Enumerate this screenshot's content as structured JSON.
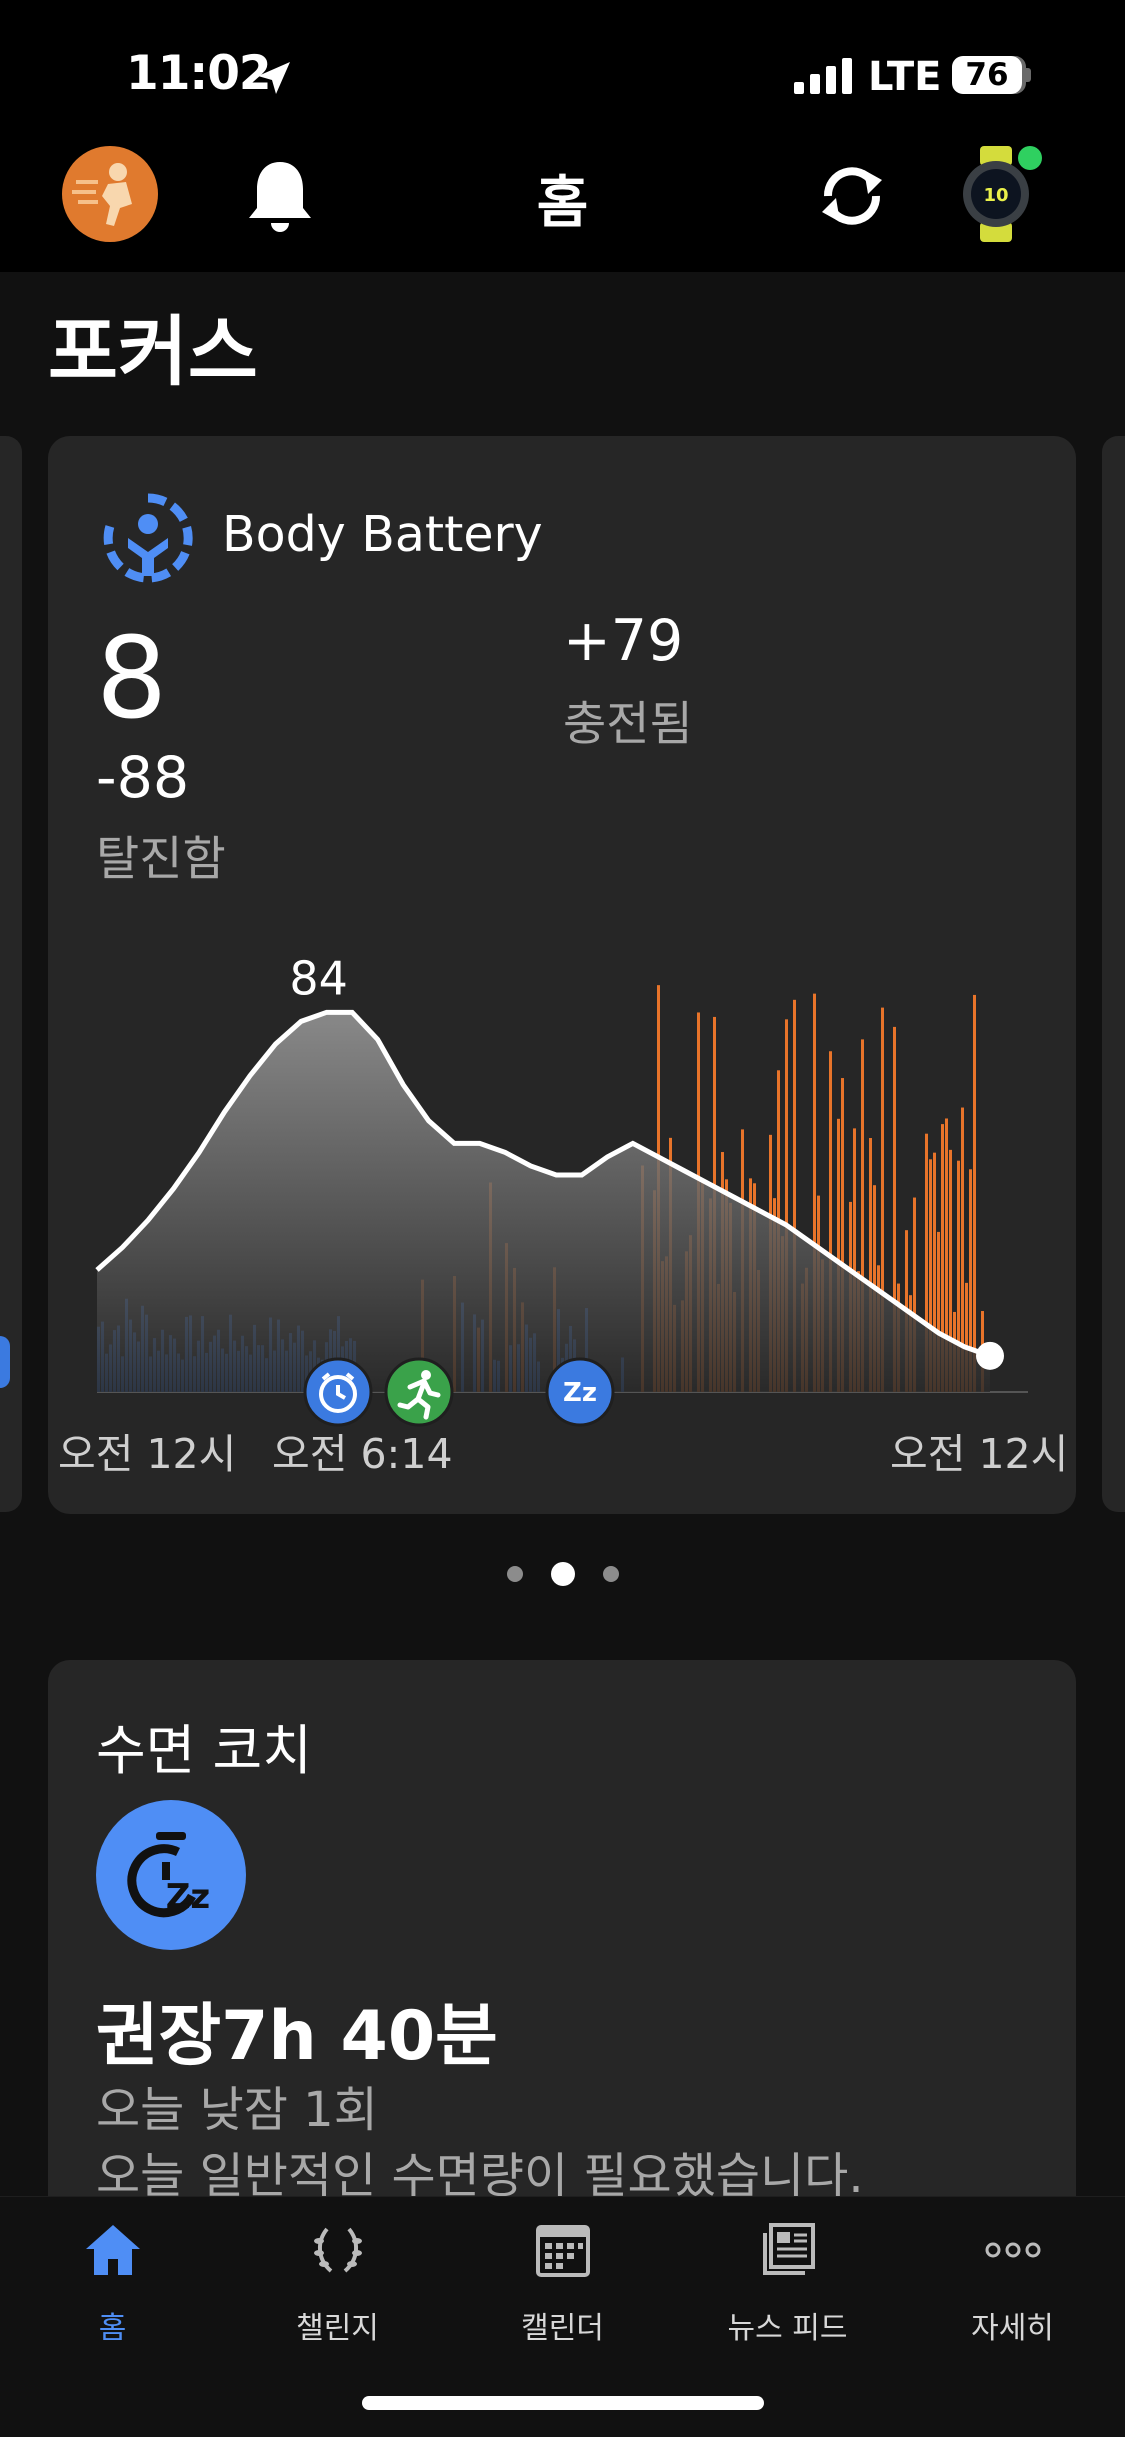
{
  "status_bar": {
    "time": "11:02",
    "network": "LTE",
    "battery": "76"
  },
  "header": {
    "title": "홈"
  },
  "focus": {
    "section_title": "포커스"
  },
  "body_battery": {
    "title": "Body Battery",
    "current": "8",
    "drained_value": "-88",
    "drained_label": "탈진함",
    "charged_value": "+79",
    "charged_label": "충전됨",
    "peak_label": "84",
    "axis_start": "오전 12시",
    "wake_time": "오전 6:14",
    "axis_end": "오전 12시",
    "colors": {
      "rest": "#3b7ae0",
      "stress": "#e8742a",
      "wake_icon": "#3b7ae0",
      "activity_icon": "#3aa24a",
      "sleep_icon": "#3b7ae0"
    },
    "chart_data": {
      "type": "area",
      "x_range": [
        "오전 12시",
        "오전 12시"
      ],
      "ylim": [
        0,
        100
      ],
      "series": [
        {
          "values": [
            27,
            32,
            38,
            45,
            53,
            62,
            70,
            77,
            82,
            84,
            84,
            78,
            68,
            60,
            55,
            55,
            53,
            50,
            48,
            48,
            52,
            55,
            52,
            49,
            46,
            43,
            40,
            37,
            33,
            29,
            25,
            21,
            17,
            13,
            10,
            8
          ]
        }
      ]
    }
  },
  "pager": {
    "count": 3,
    "active": 1
  },
  "sleep_coach": {
    "title": "수면 코치",
    "recommendation": "권장7h 40분",
    "naps": "오늘 낮잠 1회",
    "note": "오늘 일반적인 수면량이 필요했습니다."
  },
  "tabs": [
    {
      "label": "홈",
      "icon": "home-icon",
      "active": true
    },
    {
      "label": "챌린지",
      "icon": "laurel-icon",
      "active": false
    },
    {
      "label": "캘린더",
      "icon": "calendar-icon",
      "active": false
    },
    {
      "label": "뉴스 피드",
      "icon": "news-icon",
      "active": false
    },
    {
      "label": "자세히",
      "icon": "more-icon",
      "active": false
    }
  ]
}
